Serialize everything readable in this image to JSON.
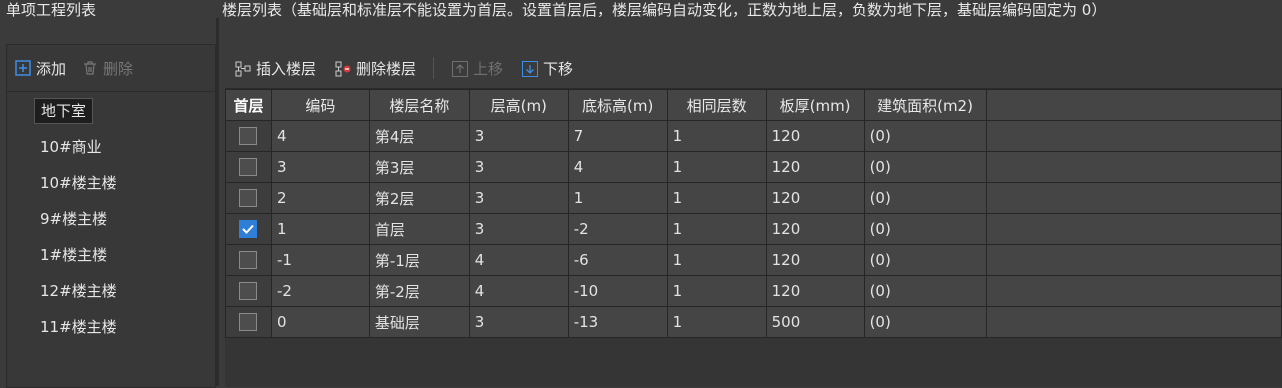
{
  "left": {
    "title": "单项工程列表",
    "add_label": "添加",
    "delete_label": "删除",
    "items": [
      "地下室",
      "10#商业",
      "10#楼主楼",
      "9#楼主楼",
      "1#楼主楼",
      "12#楼主楼",
      "11#楼主楼"
    ],
    "selected_index": 0
  },
  "right": {
    "title": "楼层列表（基础层和标准层不能设置为首层。设置首层后，楼层编码自动变化，正数为地上层，负数为地下层，基础层编码固定为 0）",
    "toolbar": {
      "insert_label": "插入楼层",
      "delete_label": "删除楼层",
      "up_label": "上移",
      "down_label": "下移"
    },
    "columns": [
      "首层",
      "编码",
      "楼层名称",
      "层高(m)",
      "底标高(m)",
      "相同层数",
      "板厚(mm)",
      "建筑面积(m2)"
    ],
    "rows": [
      {
        "first": false,
        "code": "4",
        "name": "第4层",
        "height": "3",
        "bottom": "7",
        "same": "1",
        "thickness": "120",
        "area": "(0)"
      },
      {
        "first": false,
        "code": "3",
        "name": "第3层",
        "height": "3",
        "bottom": "4",
        "same": "1",
        "thickness": "120",
        "area": "(0)"
      },
      {
        "first": false,
        "code": "2",
        "name": "第2层",
        "height": "3",
        "bottom": "1",
        "same": "1",
        "thickness": "120",
        "area": "(0)"
      },
      {
        "first": true,
        "code": "1",
        "name": "首层",
        "height": "3",
        "bottom": "-2",
        "same": "1",
        "thickness": "120",
        "area": "(0)"
      },
      {
        "first": false,
        "code": "-1",
        "name": "第-1层",
        "height": "4",
        "bottom": "-6",
        "same": "1",
        "thickness": "120",
        "area": "(0)"
      },
      {
        "first": false,
        "code": "-2",
        "name": "第-2层",
        "height": "4",
        "bottom": "-10",
        "same": "1",
        "thickness": "120",
        "area": "(0)"
      },
      {
        "first": false,
        "code": "0",
        "name": "基础层",
        "height": "3",
        "bottom": "-13",
        "same": "1",
        "thickness": "500",
        "area": "(0)"
      }
    ]
  },
  "colors": {
    "accent": "#2f7fd8",
    "background": "#3b3b3b",
    "cell": "#454545"
  }
}
